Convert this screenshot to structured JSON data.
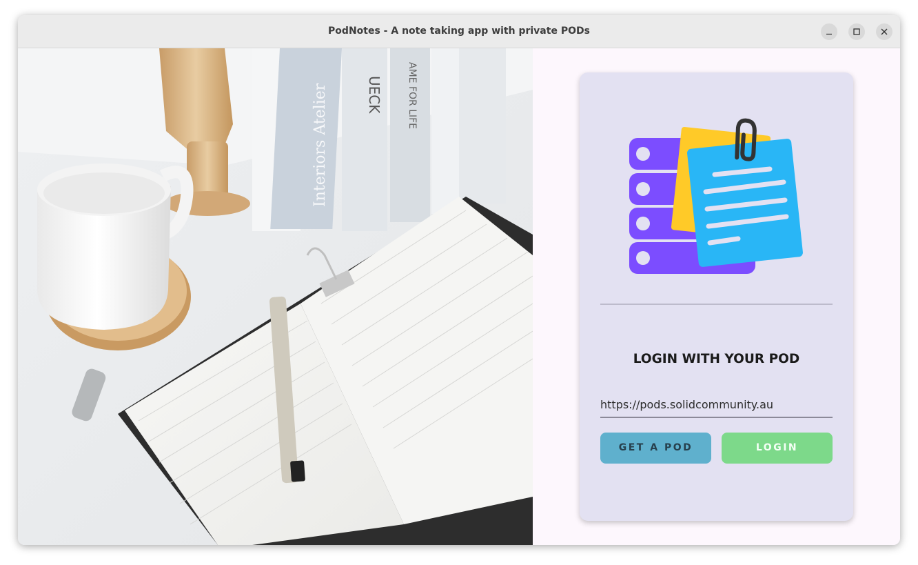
{
  "window": {
    "title": "PodNotes - A note taking app with private PODs",
    "controls": [
      "minimize-icon",
      "maximize-icon",
      "close-icon"
    ]
  },
  "hero_image": {
    "description_icon": "desk-notebook-photo"
  },
  "login_card": {
    "logo_icon": "pod-notes-logo",
    "heading": "LOGIN WITH YOUR POD",
    "server_url": "https://pods.solidcommunity.au",
    "get_pod_label": "GET A POD",
    "login_label": "LOGIN"
  },
  "colors": {
    "card_background": "#e3e1f2",
    "get_pod_button": "#5fb0cd",
    "login_button": "#7dd98a",
    "logo_purple": "#7c4dff",
    "logo_yellow": "#ffca28",
    "logo_blue": "#29b6f6"
  }
}
